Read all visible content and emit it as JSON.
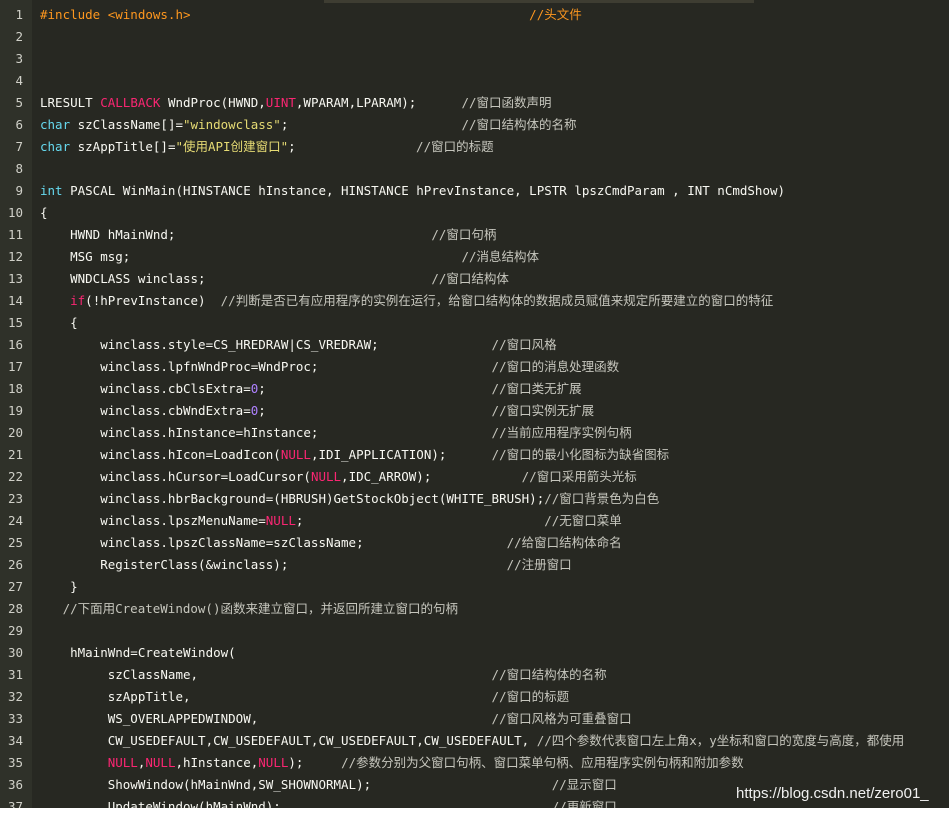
{
  "colors": {
    "default": "#f8f8f2",
    "keyword": "#f92672",
    "type": "#66d9ef",
    "string": "#e6db74",
    "number": "#ae81ff",
    "comment": "#c6c6bd",
    "preproc": "#fd971f",
    "macro": "#f92672"
  },
  "lines": [
    {
      "n": "1",
      "segs": [
        {
          "t": "#include <windows.h>",
          "c": "preproc"
        },
        {
          "t": "                                             ",
          "c": "default"
        },
        {
          "t": "//头文件",
          "c": "preproc"
        }
      ]
    },
    {
      "n": "2",
      "segs": []
    },
    {
      "n": "3",
      "segs": []
    },
    {
      "n": "4",
      "segs": []
    },
    {
      "n": "5",
      "segs": [
        {
          "t": "LRESULT ",
          "c": "default"
        },
        {
          "t": "CALLBACK",
          "c": "keyword"
        },
        {
          "t": " WndProc(HWND,",
          "c": "default"
        },
        {
          "t": "UINT",
          "c": "keyword"
        },
        {
          "t": ",WPARAM,LPARAM);      ",
          "c": "default"
        },
        {
          "t": "//窗口函数声明",
          "c": "comment"
        }
      ]
    },
    {
      "n": "6",
      "segs": [
        {
          "t": "char",
          "c": "type"
        },
        {
          "t": " szClassName[]=",
          "c": "default"
        },
        {
          "t": "\"windowclass\"",
          "c": "string"
        },
        {
          "t": ";                       ",
          "c": "default"
        },
        {
          "t": "//窗口结构体的名称",
          "c": "comment"
        }
      ]
    },
    {
      "n": "7",
      "segs": [
        {
          "t": "char",
          "c": "type"
        },
        {
          "t": " szAppTitle[]=",
          "c": "default"
        },
        {
          "t": "\"使用API创建窗口\"",
          "c": "string"
        },
        {
          "t": ";                ",
          "c": "default"
        },
        {
          "t": "//窗口的标题",
          "c": "comment"
        }
      ]
    },
    {
      "n": "8",
      "segs": []
    },
    {
      "n": "9",
      "segs": [
        {
          "t": "int",
          "c": "type"
        },
        {
          "t": " PASCAL WinMain(HINSTANCE hInstance, HINSTANCE hPrevInstance, LPSTR lpszCmdParam , INT nCmdShow)",
          "c": "default"
        }
      ]
    },
    {
      "n": "10",
      "segs": [
        {
          "t": "{",
          "c": "default"
        }
      ]
    },
    {
      "n": "11",
      "segs": [
        {
          "t": "    HWND hMainWnd;                                  ",
          "c": "default"
        },
        {
          "t": "//窗口句柄",
          "c": "comment"
        }
      ]
    },
    {
      "n": "12",
      "segs": [
        {
          "t": "    MSG msg;                                            ",
          "c": "default"
        },
        {
          "t": "//消息结构体",
          "c": "comment"
        }
      ]
    },
    {
      "n": "13",
      "segs": [
        {
          "t": "    WNDCLASS winclass;                              ",
          "c": "default"
        },
        {
          "t": "//窗口结构体",
          "c": "comment"
        }
      ]
    },
    {
      "n": "14",
      "segs": [
        {
          "t": "    ",
          "c": "default"
        },
        {
          "t": "if",
          "c": "keyword"
        },
        {
          "t": "(!hPrevInstance)  ",
          "c": "default"
        },
        {
          "t": "//判断是否已有应用程序的实例在运行，给窗口结构体的数据成员赋值来规定所要建立的窗口的特征",
          "c": "comment"
        }
      ]
    },
    {
      "n": "15",
      "segs": [
        {
          "t": "    {",
          "c": "default"
        }
      ]
    },
    {
      "n": "16",
      "segs": [
        {
          "t": "        winclass.style=CS_HREDRAW|CS_VREDRAW;               ",
          "c": "default"
        },
        {
          "t": "//窗口风格",
          "c": "comment"
        }
      ]
    },
    {
      "n": "17",
      "segs": [
        {
          "t": "        winclass.lpfnWndProc=WndProc;                       ",
          "c": "default"
        },
        {
          "t": "//窗口的消息处理函数",
          "c": "comment"
        }
      ]
    },
    {
      "n": "18",
      "segs": [
        {
          "t": "        winclass.cbClsExtra=",
          "c": "default"
        },
        {
          "t": "0",
          "c": "number"
        },
        {
          "t": ";                              ",
          "c": "default"
        },
        {
          "t": "//窗口类无扩展",
          "c": "comment"
        }
      ]
    },
    {
      "n": "19",
      "segs": [
        {
          "t": "        winclass.cbWndExtra=",
          "c": "default"
        },
        {
          "t": "0",
          "c": "number"
        },
        {
          "t": ";                              ",
          "c": "default"
        },
        {
          "t": "//窗口实例无扩展",
          "c": "comment"
        }
      ]
    },
    {
      "n": "20",
      "segs": [
        {
          "t": "        winclass.hInstance=hInstance;                       ",
          "c": "default"
        },
        {
          "t": "//当前应用程序实例句柄",
          "c": "comment"
        }
      ]
    },
    {
      "n": "21",
      "segs": [
        {
          "t": "        winclass.hIcon=LoadIcon(",
          "c": "default"
        },
        {
          "t": "NULL",
          "c": "keyword"
        },
        {
          "t": ",IDI_APPLICATION);      ",
          "c": "default"
        },
        {
          "t": "//窗口的最小化图标为缺省图标",
          "c": "comment"
        }
      ]
    },
    {
      "n": "22",
      "segs": [
        {
          "t": "        winclass.hCursor=LoadCursor(",
          "c": "default"
        },
        {
          "t": "NULL",
          "c": "keyword"
        },
        {
          "t": ",IDC_ARROW);            ",
          "c": "default"
        },
        {
          "t": "//窗口采用箭头光标",
          "c": "comment"
        }
      ]
    },
    {
      "n": "23",
      "segs": [
        {
          "t": "        winclass.hbrBackground=(HBRUSH)GetStockObject(WHITE_BRUSH);",
          "c": "default"
        },
        {
          "t": "//窗口背景色为白色",
          "c": "comment"
        }
      ]
    },
    {
      "n": "24",
      "segs": [
        {
          "t": "        winclass.lpszMenuName=",
          "c": "default"
        },
        {
          "t": "NULL",
          "c": "keyword"
        },
        {
          "t": ";                                ",
          "c": "default"
        },
        {
          "t": "//无窗口菜单",
          "c": "comment"
        }
      ]
    },
    {
      "n": "25",
      "segs": [
        {
          "t": "        winclass.lpszClassName=szClassName;                   ",
          "c": "default"
        },
        {
          "t": "//给窗口结构体命名",
          "c": "comment"
        }
      ]
    },
    {
      "n": "26",
      "segs": [
        {
          "t": "        RegisterClass(&winclass);                             ",
          "c": "default"
        },
        {
          "t": "//注册窗口",
          "c": "comment"
        }
      ]
    },
    {
      "n": "27",
      "segs": [
        {
          "t": "    }",
          "c": "default"
        }
      ]
    },
    {
      "n": "28",
      "segs": [
        {
          "t": "   ",
          "c": "default"
        },
        {
          "t": "//下面用CreateWindow()函数来建立窗口，并返回所建立窗口的句柄",
          "c": "comment"
        }
      ]
    },
    {
      "n": "29",
      "segs": []
    },
    {
      "n": "30",
      "segs": [
        {
          "t": "    hMainWnd=CreateWindow(",
          "c": "default"
        }
      ]
    },
    {
      "n": "31",
      "segs": [
        {
          "t": "         szClassName,                                       ",
          "c": "default"
        },
        {
          "t": "//窗口结构体的名称",
          "c": "comment"
        }
      ]
    },
    {
      "n": "32",
      "segs": [
        {
          "t": "         szAppTitle,                                        ",
          "c": "default"
        },
        {
          "t": "//窗口的标题",
          "c": "comment"
        }
      ]
    },
    {
      "n": "33",
      "segs": [
        {
          "t": "         WS_OVERLAPPEDWINDOW,                               ",
          "c": "default"
        },
        {
          "t": "//窗口风格为可重叠窗口",
          "c": "comment"
        }
      ]
    },
    {
      "n": "34",
      "segs": [
        {
          "t": "         CW_USEDEFAULT,CW_USEDEFAULT,CW_USEDEFAULT,CW_USEDEFAULT, ",
          "c": "default"
        },
        {
          "t": "//四个参数代表窗口左上角x，y坐标和窗口的宽度与高度，都使用",
          "c": "comment"
        }
      ]
    },
    {
      "n": "35",
      "segs": [
        {
          "t": "         ",
          "c": "default"
        },
        {
          "t": "NULL",
          "c": "keyword"
        },
        {
          "t": ",",
          "c": "default"
        },
        {
          "t": "NULL",
          "c": "keyword"
        },
        {
          "t": ",hInstance,",
          "c": "default"
        },
        {
          "t": "NULL",
          "c": "keyword"
        },
        {
          "t": ");     ",
          "c": "default"
        },
        {
          "t": "//参数分别为父窗口句柄、窗口菜单句柄、应用程序实例句柄和附加参数",
          "c": "comment"
        }
      ]
    },
    {
      "n": "36",
      "segs": [
        {
          "t": "         ShowWindow(hMainWnd,SW_SHOWNORMAL);                        ",
          "c": "default"
        },
        {
          "t": "//显示窗口",
          "c": "comment"
        }
      ]
    },
    {
      "n": "37",
      "segs": [
        {
          "t": "         UpdateWindow(hMainWnd);                                    ",
          "c": "default"
        },
        {
          "t": "//更新窗口",
          "c": "comment"
        }
      ]
    }
  ],
  "watermark": "https://blog.csdn.net/zero01_"
}
